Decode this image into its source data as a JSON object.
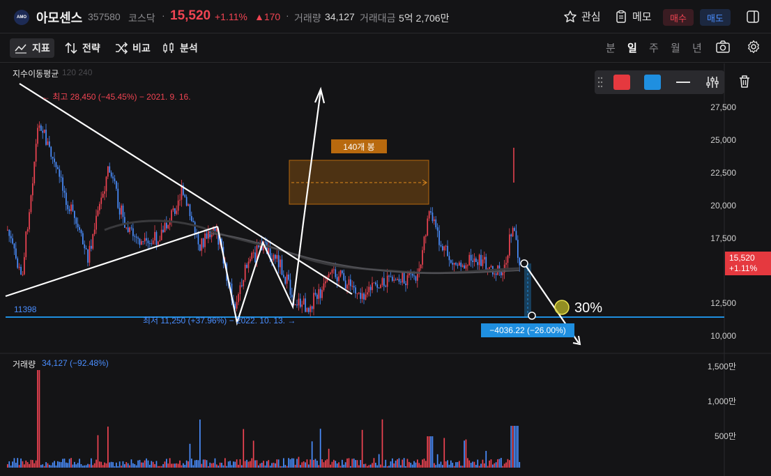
{
  "header": {
    "logo_text": "AMO",
    "name": "아모센스",
    "code": "357580",
    "market": "코스닥",
    "separator": "·",
    "price": "15,520",
    "change_pct": "+1.11%",
    "change_abs": "▲170",
    "volume_label": "거래량",
    "volume_value": "34,127",
    "amount_label": "거래대금",
    "amount_value": "5억 2,706만",
    "fav_label": "관심",
    "memo_label": "메모",
    "buy_label": "매수",
    "sell_label": "매도"
  },
  "toolbar": {
    "indicator": "지표",
    "strategy": "전략",
    "compare": "비교",
    "analysis": "분석",
    "periods": [
      "분",
      "일",
      "주",
      "월",
      "년"
    ],
    "active_period": "일"
  },
  "chart": {
    "indicator_label": "지수이동평균",
    "indicator_params": "120 240",
    "high_note": "← 최고 28,450 (−45.45%) − 2021. 9. 16.",
    "low_note": "최저 11,250 (+37.96%) − 2022. 10. 13. →",
    "level_label": "11398",
    "measure_label": "−4036.22 (−26.00%)",
    "percent_label": "30%",
    "bars_label": "140개 봉",
    "y_ticks": [
      "27,500",
      "25,000",
      "22,500",
      "20,000",
      "17,500",
      "12,500",
      "10,000"
    ],
    "current_price": "15,520",
    "current_pct": "+1.11%",
    "volume_label": "거래량",
    "volume_value": "34,127 (−92.48%)",
    "vol_ticks": [
      "1,500만",
      "1,000만",
      "500만"
    ]
  },
  "colors": {
    "up": "#f04452",
    "down": "#4a8eff",
    "background": "#141416",
    "accent_blue": "#1f8fe0",
    "accent_red": "#e5393f"
  }
}
